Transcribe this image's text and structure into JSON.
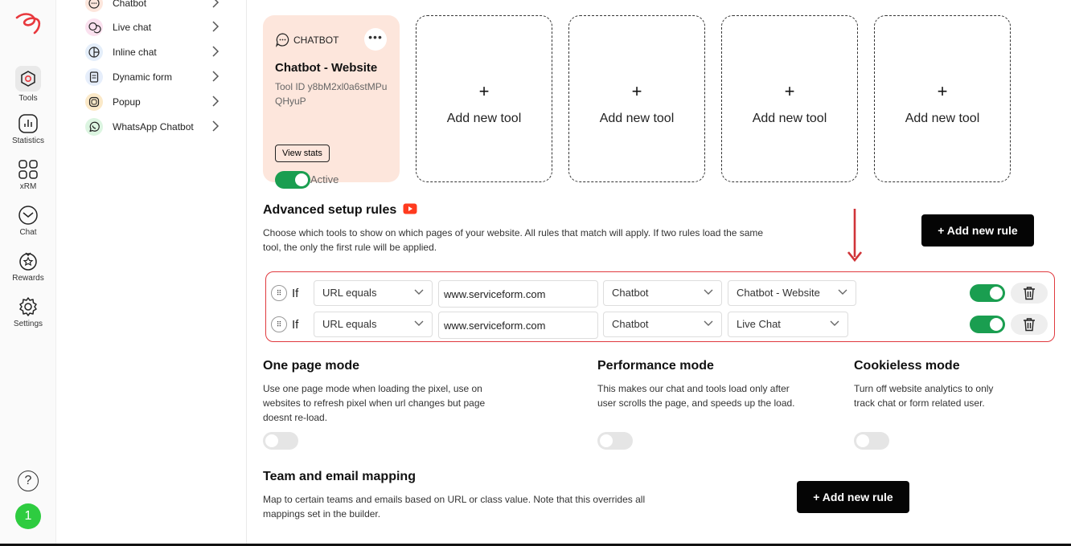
{
  "rail": {
    "items": [
      {
        "label": "Tools",
        "icon": "tools-icon"
      },
      {
        "label": "Statistics",
        "icon": "statistics-icon"
      },
      {
        "label": "xRM",
        "icon": "grid-icon"
      },
      {
        "label": "Chat",
        "icon": "chat-icon"
      },
      {
        "label": "Rewards",
        "icon": "rewards-icon"
      },
      {
        "label": "Settings",
        "icon": "gear-icon"
      }
    ],
    "help": "?",
    "avatar": "1"
  },
  "tool_menu": [
    {
      "label": "Chatbot"
    },
    {
      "label": "Live chat"
    },
    {
      "label": "Inline chat"
    },
    {
      "label": "Dynamic form"
    },
    {
      "label": "Popup"
    },
    {
      "label": "WhatsApp Chatbot"
    }
  ],
  "tool_card": {
    "type": "CHATBOT",
    "title": "Chatbot - Website",
    "tool_id": "Tool ID y8bM2xl0a6stMPuQHyuP",
    "view_stats": "View stats",
    "status": "Active"
  },
  "add_tool_label": "Add new tool",
  "add_tool_plus": "+",
  "advanced": {
    "title": "Advanced setup rules",
    "description": "Choose which tools to show on which pages of your website. All rules that match will apply. If two rules load the same tool, the only the first rule will be applied.",
    "add_rule": "+ Add new rule"
  },
  "rules": [
    {
      "if": "If",
      "condition": "URL equals",
      "url": "www.serviceform.com",
      "tool_type": "Chatbot",
      "tool": "Chatbot - Website",
      "enabled": true
    },
    {
      "if": "If",
      "condition": "URL equals",
      "url": "www.serviceform.com",
      "tool_type": "Chatbot",
      "tool": "Live Chat",
      "enabled": true
    }
  ],
  "modes": [
    {
      "title": "One page mode",
      "description": "Use one page mode when loading the pixel, use on websites to refresh pixel when url changes but page doesnt re-load.",
      "enabled": false
    },
    {
      "title": "Performance mode",
      "description": "This makes our chat and tools load only after user scrolls the page, and speeds up the load.",
      "enabled": false
    },
    {
      "title": "Cookieless mode",
      "description": "Turn off website analytics to only track chat or form related user.",
      "enabled": false
    }
  ],
  "team": {
    "title": "Team and email mapping",
    "description": "Map to certain teams and emails based on URL or class value. Note that this overrides all mappings set in the builder.",
    "add_rule": "+ Add new rule"
  },
  "colors": {
    "accent_green": "#1a9e50",
    "card_bg": "#fde6dc",
    "highlight_red": "#e0393e",
    "logo_red": "#e8383d"
  }
}
